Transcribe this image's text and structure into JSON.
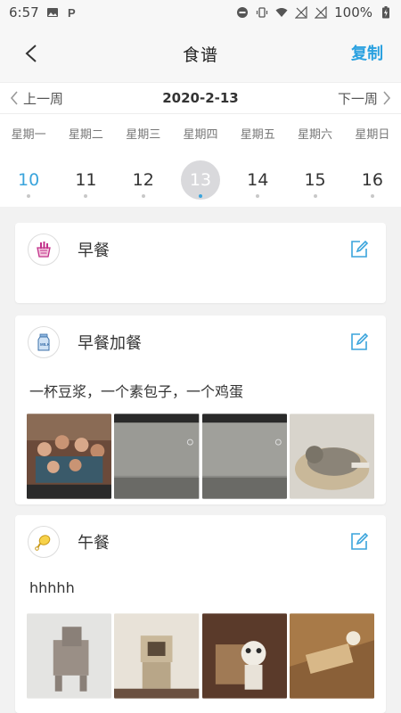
{
  "status": {
    "time": "6:57",
    "battery": "100%"
  },
  "header": {
    "title": "食谱",
    "copy_label": "复制"
  },
  "week_nav": {
    "prev_label": "上一周",
    "date": "2020-2-13",
    "next_label": "下一周"
  },
  "weekdays": [
    "星期一",
    "星期二",
    "星期三",
    "星期四",
    "星期五",
    "星期六",
    "星期日"
  ],
  "days": [
    "10",
    "11",
    "12",
    "13",
    "14",
    "15",
    "16"
  ],
  "today": "10",
  "selected": "13",
  "colors": {
    "accent": "#2aa1e0",
    "selected_bg": "#d9d9dc"
  },
  "meals": [
    {
      "title": "早餐",
      "icon": "breakfast-basket-icon",
      "description": "",
      "photos": []
    },
    {
      "title": "早餐加餐",
      "icon": "milk-bottle-icon",
      "description": "一杯豆浆，一个素包子，一个鸡蛋",
      "photos": [
        "group-photo",
        "laptop-photo",
        "laptop-photo",
        "cat-photo"
      ]
    },
    {
      "title": "午餐",
      "icon": "chicken-leg-icon",
      "description": "hhhhh",
      "photos": [
        "dog-cardboard-photo",
        "pug-cardboard-photo",
        "cat-dog-cardboard-photo",
        "cat-box-photo"
      ]
    }
  ]
}
